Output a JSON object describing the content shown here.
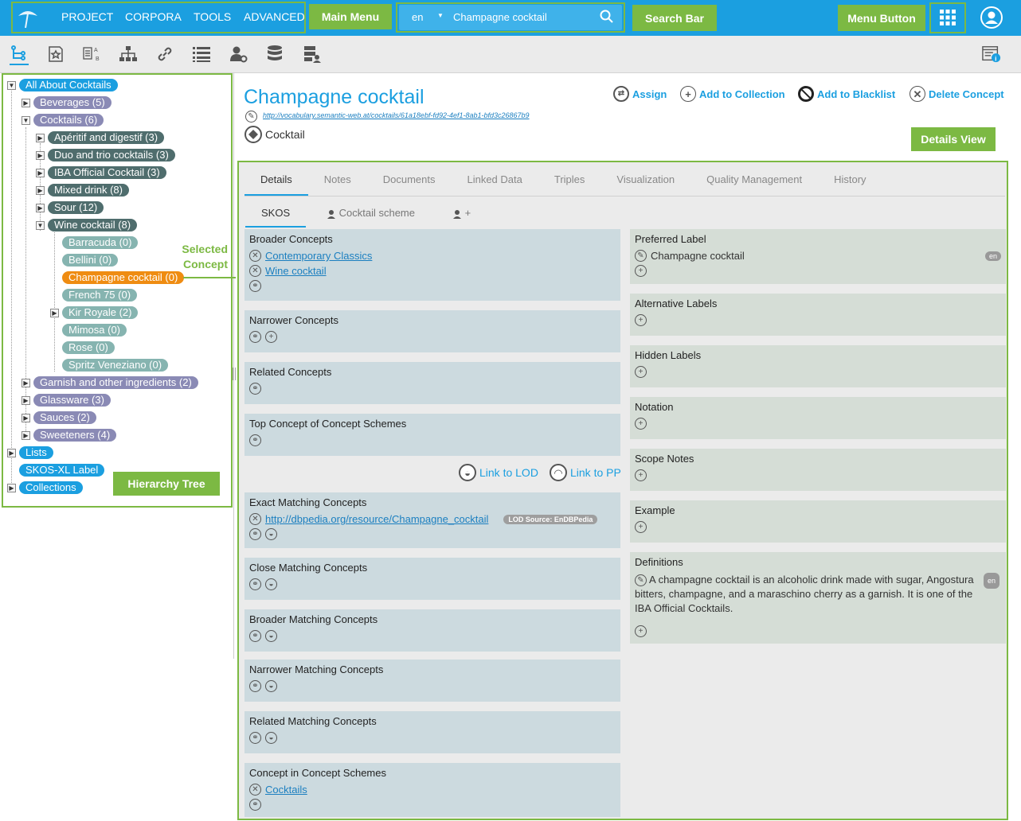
{
  "header": {
    "menu": [
      "PROJECT",
      "CORPORA",
      "TOOLS",
      "ADVANCED"
    ],
    "search": {
      "lang": "en",
      "value": "Champagne cocktail"
    },
    "colors": {
      "brand": "#1b9fe0",
      "callout": "#7cb943",
      "selected": "#ef8c12"
    }
  },
  "callouts": {
    "main_menu": "Main Menu",
    "search_bar": "Search Bar",
    "menu_button": "Menu Button",
    "selected_concept": "Selected\nConcept",
    "hierarchy_tree": "Hierarchy Tree",
    "details_view": "Details View"
  },
  "tree": {
    "root": "All About Cocktails",
    "beverages": "Beverages (5)",
    "cocktails": "Cocktails (6)",
    "aperitif": "Apéritif and digestif (3)",
    "duo": "Duo and trio cocktails (3)",
    "iba": "IBA Official Cocktail (3)",
    "mixed": "Mixed drink (8)",
    "sour": "Sour (12)",
    "wine": "Wine cocktail (8)",
    "barracuda": "Barracuda (0)",
    "bellini": "Bellini (0)",
    "champagne": "Champagne cocktail (0)",
    "french": "French 75 (0)",
    "kir": "Kir Royale (2)",
    "mimosa": "Mimosa (0)",
    "rose": "Rose (0)",
    "spritz": "Spritz Veneziano (0)",
    "garnish": "Garnish and other ingredients (2)",
    "glassware": "Glassware (3)",
    "sauces": "Sauces (2)",
    "sweeteners": "Sweeteners (4)",
    "lists": "Lists",
    "skosxl": "SKOS-XL Label",
    "collections": "Collections"
  },
  "concept": {
    "title": "Champagne cocktail",
    "uri": "http://vocabulary.semantic-web.at/cocktails/61a18ebf-fd92-4ef1-8ab1-bfd3c26867b9",
    "type": "Cocktail"
  },
  "actions": {
    "assign": "Assign",
    "add_collection": "Add to Collection",
    "add_blacklist": "Add to Blacklist",
    "delete": "Delete Concept"
  },
  "tabs": [
    "Details",
    "Notes",
    "Documents",
    "Linked Data",
    "Triples",
    "Visualization",
    "Quality Management",
    "History"
  ],
  "subtabs": {
    "skos": "SKOS",
    "scheme": "Cocktail scheme",
    "plus": "+"
  },
  "left_panels": {
    "broader": "Broader Concepts",
    "broader_items": [
      "Contemporary Classics",
      "Wine cocktail"
    ],
    "narrower": "Narrower Concepts",
    "related": "Related Concepts",
    "top_concept": "Top Concept of Concept Schemes",
    "link_lod": "Link to LOD",
    "link_pp": "Link to PP",
    "exact": "Exact Matching Concepts",
    "exact_item": "http://dbpedia.org/resource/Champagne_cocktail",
    "lod_source": "LOD Source: EnDBPedia",
    "close": "Close Matching Concepts",
    "broader_match": "Broader Matching Concepts",
    "narrower_match": "Narrower Matching Concepts",
    "related_match": "Related Matching Concepts",
    "in_schemes": "Concept in Concept Schemes",
    "in_schemes_item": "Cocktails"
  },
  "right_panels": {
    "pref": "Preferred Label",
    "pref_value": "Champagne cocktail",
    "lang": "en",
    "alt": "Alternative Labels",
    "hidden": "Hidden Labels",
    "notation": "Notation",
    "scope": "Scope Notes",
    "example": "Example",
    "definitions": "Definitions",
    "definition_text": "A champagne cocktail is an alcoholic drink made with sugar, Angostura bitters, champagne, and a maraschino cherry as a garnish. It is one of the IBA Official Cocktails."
  }
}
